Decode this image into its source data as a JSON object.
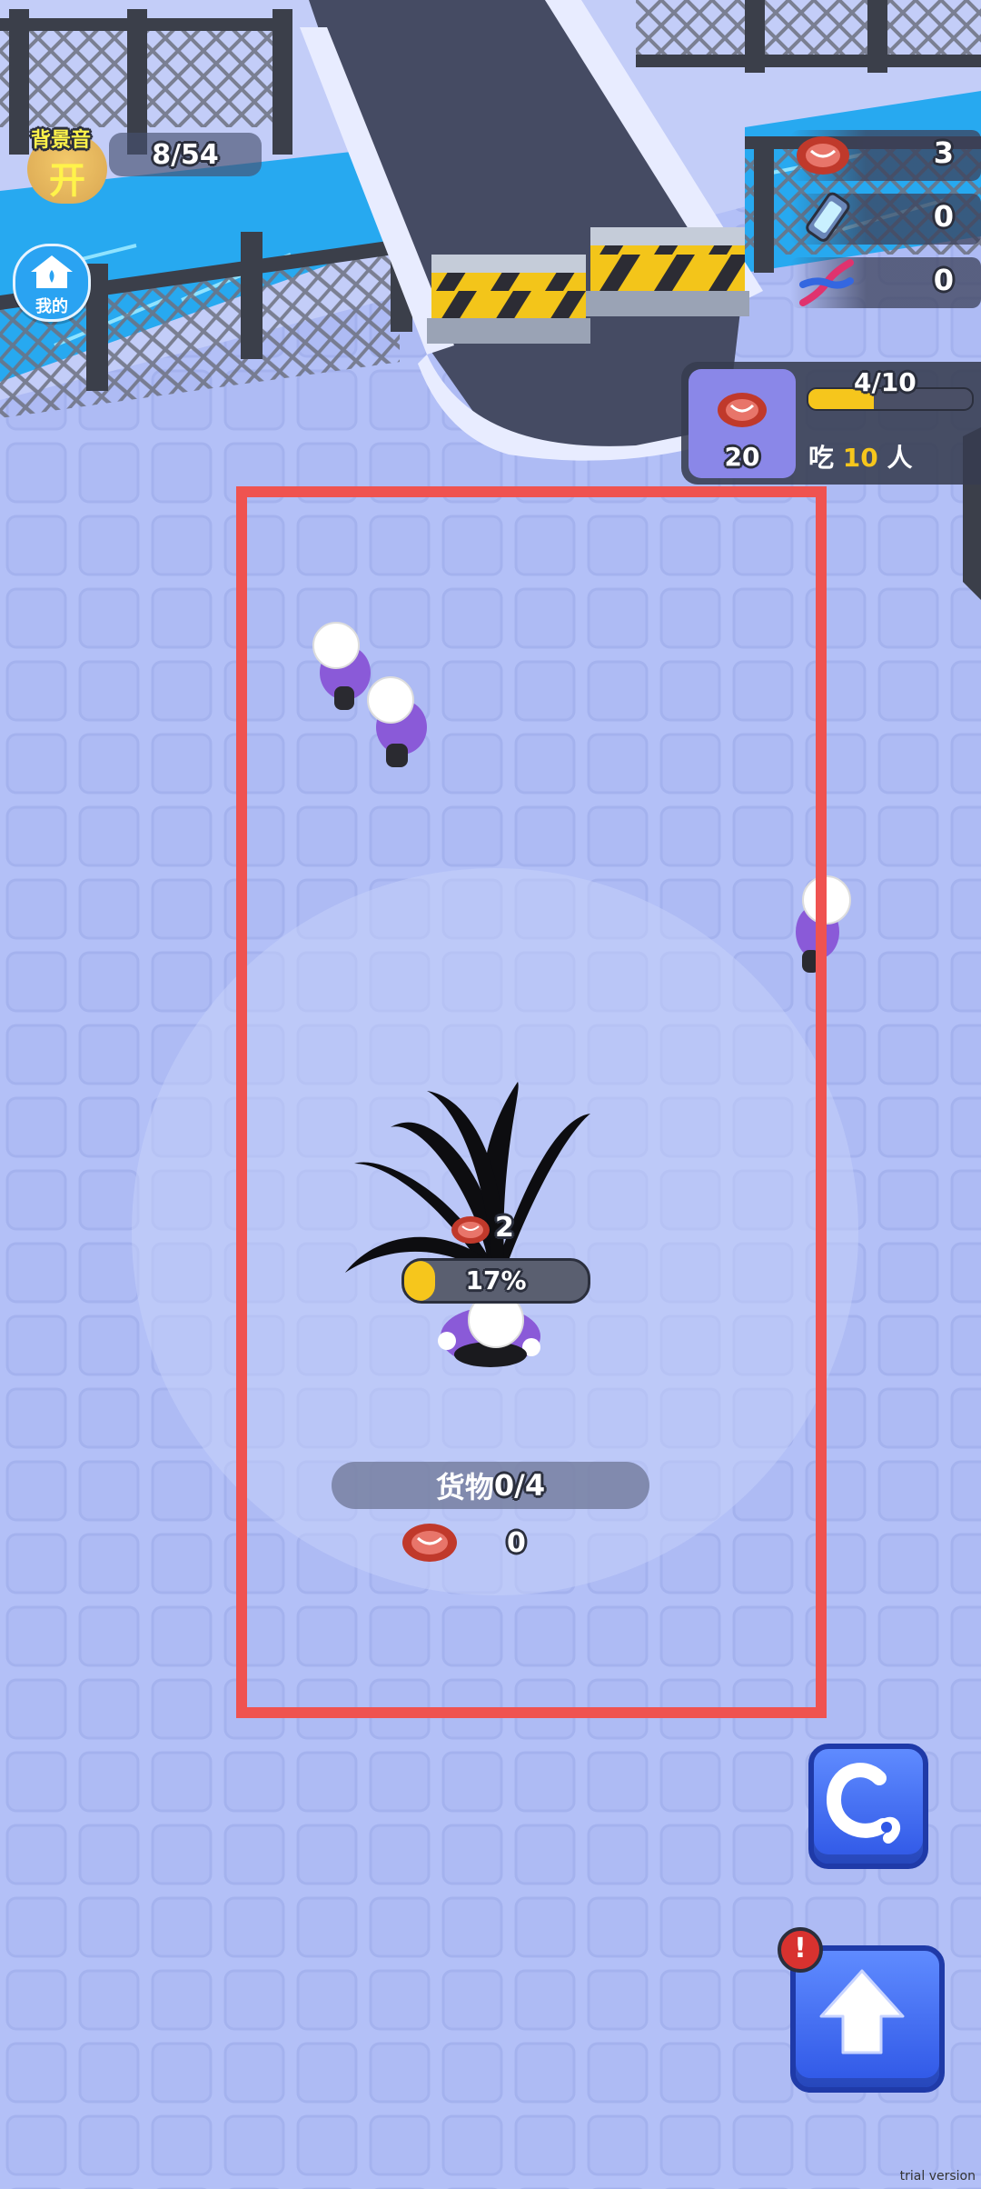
{
  "music": {
    "label": "背景音",
    "state": "开"
  },
  "home": {
    "label": "我的"
  },
  "population": {
    "text": "8/54"
  },
  "resources": [
    {
      "icon": "meat-icon",
      "value": "3"
    },
    {
      "icon": "battery-icon",
      "value": "0"
    },
    {
      "icon": "dna-icon",
      "value": "0"
    }
  ],
  "eat_panel": {
    "meat_count": "20",
    "progress_text": "4/10",
    "progress": 0.4,
    "eat_prefix": "吃",
    "eat_number": "10",
    "eat_suffix": "人"
  },
  "player": {
    "carry_count": "2",
    "progress_text": "17%",
    "progress": 0.17
  },
  "cargo": {
    "label": "货物",
    "count": "0/4",
    "meat_value": "0"
  },
  "buttons": {
    "skill_icon": "curl-skill-icon",
    "upgrade_icon": "up-arrow-icon",
    "alert": "!"
  },
  "watermark": "trial version",
  "colors": {
    "ground": "#b3c0f7",
    "zone_border": "#ef5350",
    "progress_fill": "#f6c61c",
    "npc_shirt": "#8a5ad8",
    "button_blue": "#3d66f0"
  }
}
